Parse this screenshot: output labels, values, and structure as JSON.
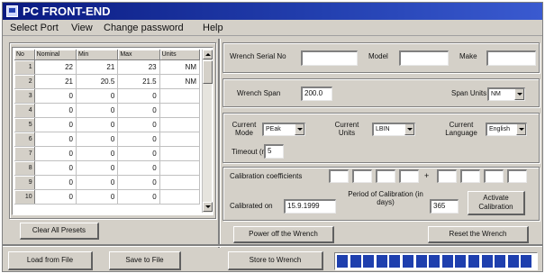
{
  "window": {
    "title": "PC FRONT-END"
  },
  "menu": [
    "Select Port",
    "View",
    "Change password",
    "Help"
  ],
  "presets_table": {
    "columns": [
      "No",
      "Nominal",
      "Min",
      "Max",
      "Units"
    ],
    "rows": [
      [
        "1",
        "22",
        "21",
        "23",
        "NM"
      ],
      [
        "2",
        "21",
        "20.5",
        "21.5",
        "NM"
      ],
      [
        "3",
        "0",
        "0",
        "0",
        ""
      ],
      [
        "4",
        "0",
        "0",
        "0",
        ""
      ],
      [
        "5",
        "0",
        "0",
        "0",
        ""
      ],
      [
        "6",
        "0",
        "0",
        "0",
        ""
      ],
      [
        "7",
        "0",
        "0",
        "0",
        ""
      ],
      [
        "8",
        "0",
        "0",
        "0",
        ""
      ],
      [
        "9",
        "0",
        "0",
        "0",
        ""
      ],
      [
        "10",
        "0",
        "0",
        "0",
        ""
      ]
    ]
  },
  "buttons": {
    "clear_presets": "Clear All Presets",
    "load_from_file": "Load from File",
    "save_to_file": "Save to File",
    "store_to_wrench": "Store to Wrench",
    "power_off": "Power off the Wrench",
    "reset": "Reset the Wrench",
    "activate_calibration": "Activate Calibration"
  },
  "identity": {
    "serial_label": "Wrench Serial No",
    "serial_value": "",
    "model_label": "Model",
    "model_value": "",
    "make_label": "Make",
    "make_value": ""
  },
  "span": {
    "label": "Wrench Span",
    "value": "200.0",
    "units_label": "Span Units",
    "units_value": "NM"
  },
  "settings": {
    "mode_label": "Current Mode",
    "mode_value": "PEak",
    "units_label": "Current Units",
    "units_value": "LBIN",
    "language_label": "Current Language",
    "language_value": "English",
    "timeout_label": "Timeout (min)",
    "timeout_value": "5"
  },
  "calibration": {
    "coeff_label": "Calibration coefficients",
    "sign_a": "+",
    "sign_b": "+",
    "coeffs_a": [
      "",
      "",
      "",
      ""
    ],
    "coeffs_b": [
      "",
      "",
      "",
      ""
    ],
    "calibrated_label": "Calibrated on",
    "calibrated_value": "15.9.1999",
    "period_label": "Period of Calibration (in days)",
    "period_value": "365"
  },
  "progress": {
    "segments": 15,
    "color": "#1e3fae"
  }
}
